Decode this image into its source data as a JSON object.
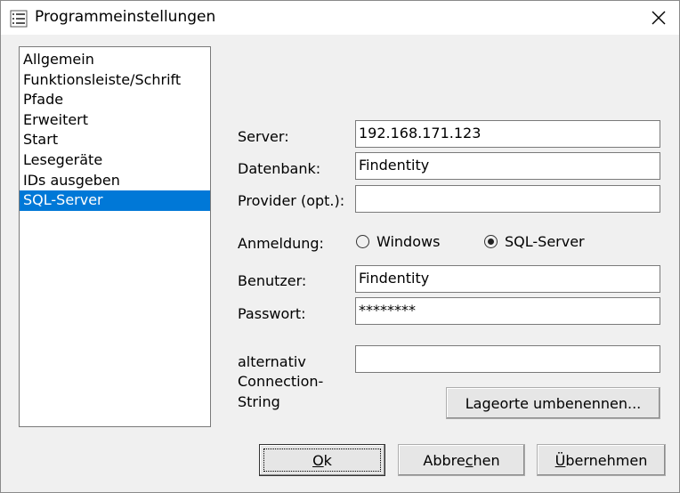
{
  "window": {
    "title": "Programmeinstellungen"
  },
  "nav": {
    "items": [
      "Allgemein",
      "Funktionsleiste/Schrift",
      "Pfade",
      "Erweitert",
      "Start",
      "Lesegeräte",
      "IDs ausgeben",
      "SQL-Server"
    ],
    "selected": "SQL-Server"
  },
  "form": {
    "server_label": "Server:",
    "server_value": "192.168.171.123",
    "db_label": "Datenbank:",
    "db_value": "Findentity",
    "provider_label": "Provider (opt.):",
    "provider_value": "",
    "login_label": "Anmeldung:",
    "login_windows": "Windows",
    "login_sql": "SQL-Server",
    "login_selected": "SQL-Server",
    "user_label": "Benutzer:",
    "user_value": "Findentity",
    "pass_label": "Passwort:",
    "pass_value": "********",
    "alt_label_1": "alternativ",
    "alt_label_2": "Connection-",
    "alt_label_3": "String",
    "alt_value": ""
  },
  "buttons": {
    "rename": "Lageorte umbenennen...",
    "ok_underlined": "O",
    "ok_rest": "k",
    "cancel_pre": "Abbre",
    "cancel_underlined": "c",
    "cancel_post": "hen",
    "apply_underlined": "Ü",
    "apply_rest": "bernehmen"
  },
  "colors": {
    "selection": "#0078d7",
    "window_bg": "#f0f0f0"
  }
}
